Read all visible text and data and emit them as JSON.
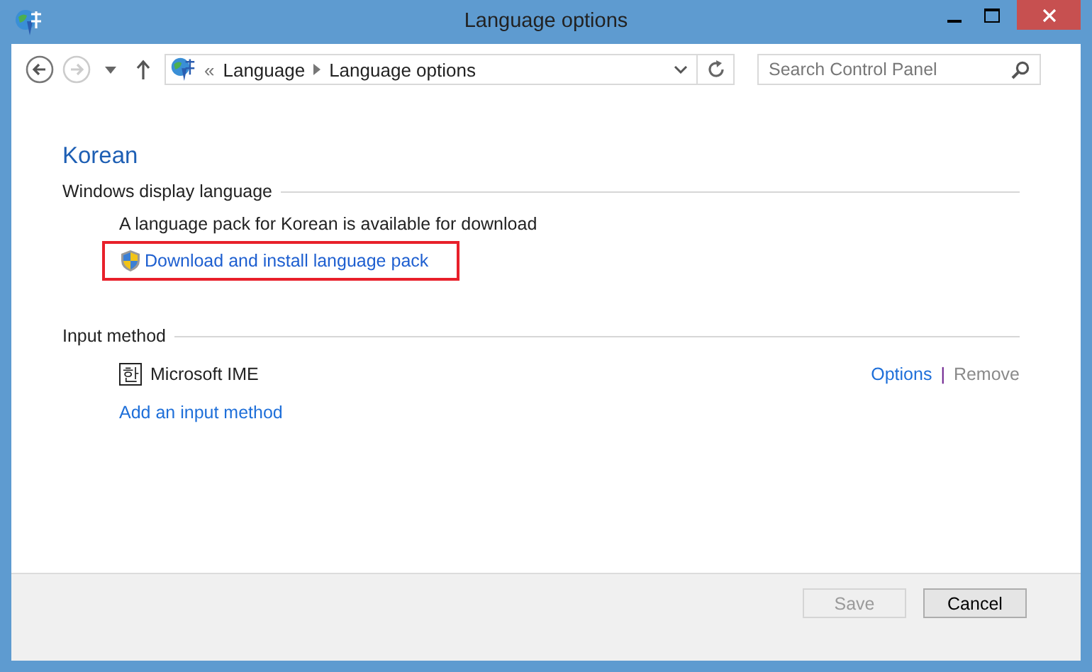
{
  "window": {
    "title": "Language options"
  },
  "address_bar": {
    "overflow": "«",
    "crumbs": [
      "Language",
      "Language options"
    ]
  },
  "search": {
    "placeholder": "Search Control Panel"
  },
  "heading": "Korean",
  "display_language": {
    "title": "Windows display language",
    "message": "A language pack for Korean is available for download",
    "link": {
      "label": "Download and install language pack",
      "highlighted": true
    }
  },
  "input_method": {
    "title": "Input method",
    "methods": [
      {
        "glyph": "한",
        "name": "Microsoft IME",
        "options": {
          "label": "Options",
          "disabled": false
        },
        "separator": "|",
        "remove": {
          "label": "Remove",
          "disabled": true
        }
      }
    ],
    "add_link": "Add an input method"
  },
  "buttons": [
    {
      "label": "Save",
      "disabled": true
    },
    {
      "label": "Cancel",
      "disabled": false
    }
  ]
}
